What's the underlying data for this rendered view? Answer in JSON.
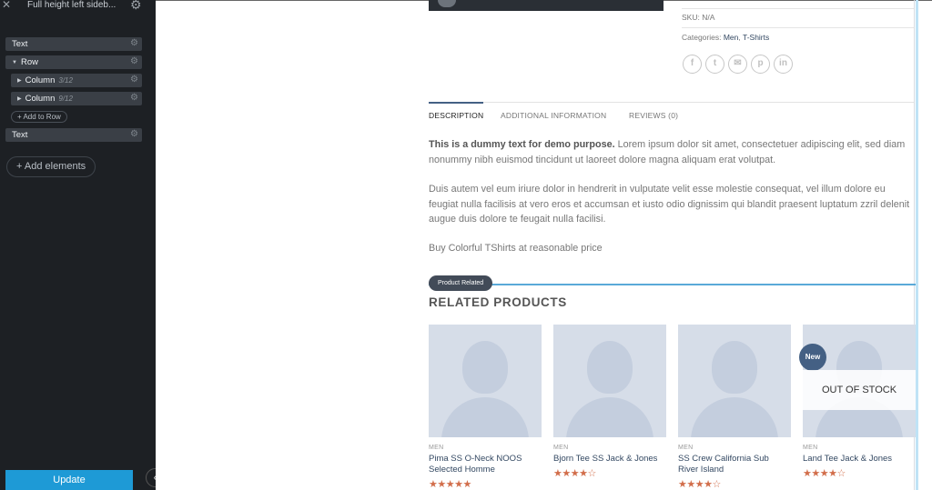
{
  "sidebar": {
    "title": "Full height left sideb...",
    "tree": [
      {
        "label": "Text"
      },
      {
        "label": "Row"
      },
      {
        "label": "Column",
        "sub": "3/12"
      },
      {
        "label": "Column",
        "sub": "9/12"
      },
      {
        "label": "Text"
      }
    ],
    "add_to_row": "+ Add to Row",
    "add_elements": "+ Add elements",
    "update": "Update"
  },
  "product": {
    "sku": "SKU: N/A",
    "categories_label": "Categories:",
    "categories": [
      "Men",
      "T-Shirts"
    ],
    "share_icons": [
      "facebook-icon",
      "twitter-icon",
      "email-icon",
      "pinterest-icon",
      "linkedin-icon"
    ]
  },
  "tabs": [
    {
      "label": "DESCRIPTION",
      "active": true
    },
    {
      "label": "ADDITIONAL INFORMATION",
      "active": false
    },
    {
      "label": "REVIEWS (0)",
      "active": false
    }
  ],
  "description": {
    "bold_lead": "This is a dummy text for demo purpose.",
    "p1_rest": " Lorem ipsum dolor sit amet, consectetuer adipiscing elit, sed diam nonummy nibh euismod tincidunt ut laoreet dolore magna aliquam erat volutpat.",
    "p2": "Duis autem vel eum iriure dolor in hendrerit in vulputate velit esse molestie consequat, vel illum dolore eu feugiat nulla facilisis at vero eros et accumsan et iusto odio dignissim qui blandit praesent luptatum zzril delenit augue duis dolore te feugait nulla facilisi.",
    "p3": "Buy Colorful TShirts at reasonable price"
  },
  "related": {
    "badge": "Product Related",
    "title": "RELATED PRODUCTS",
    "products": [
      {
        "category": "MEN",
        "name": "Pima SS O-Neck NOOS Selected Homme",
        "stars": "★★★★★"
      },
      {
        "category": "MEN",
        "name": "Bjorn Tee SS Jack & Jones",
        "stars": "★★★★☆"
      },
      {
        "category": "MEN",
        "name": "SS Crew California Sub River Island",
        "stars": "★★★★☆"
      },
      {
        "category": "MEN",
        "name": "Land Tee Jack & Jones",
        "stars": "★★★★☆",
        "badge": "New",
        "overlay": "OUT OF STOCK"
      }
    ]
  },
  "colors": {
    "sidebar_bg": "#1d2024",
    "accent": "#1e9ad6",
    "link": "#334862",
    "star": "#d26e4b"
  }
}
